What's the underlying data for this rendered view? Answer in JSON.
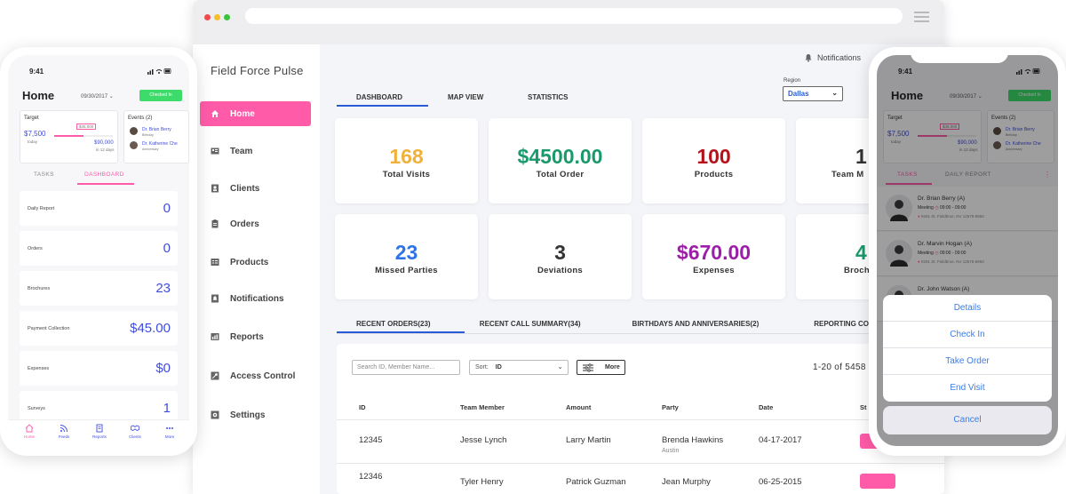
{
  "web": {
    "app_title": "Field Force Pulse",
    "notifications": "Notifications",
    "region_label": "Region",
    "region_value": "Dallas",
    "nav": [
      {
        "label": "Home",
        "icon": "home-icon"
      },
      {
        "label": "Team",
        "icon": "team-icon"
      },
      {
        "label": "Clients",
        "icon": "clients-icon"
      },
      {
        "label": "Orders",
        "icon": "orders-icon"
      },
      {
        "label": "Products",
        "icon": "products-icon"
      },
      {
        "label": "Notifications",
        "icon": "bell-icon"
      },
      {
        "label": "Reports",
        "icon": "reports-icon"
      },
      {
        "label": "Access Control",
        "icon": "key-icon"
      },
      {
        "label": "Settings",
        "icon": "gear-icon"
      }
    ],
    "tabs": [
      "DASHBOARD",
      "MAP VIEW",
      "STATISTICS"
    ],
    "cards": [
      {
        "value": "168",
        "label": "Total Visits",
        "color": "#f0b13c"
      },
      {
        "value": "$4500.00",
        "label": "Total Order",
        "color": "#1a9a6c"
      },
      {
        "value": "100",
        "label": "Products",
        "color": "#b5121b"
      },
      {
        "value": "1",
        "label": "Team M",
        "color": "#333333"
      },
      {
        "value": "23",
        "label": "Missed Parties",
        "color": "#2f74e6"
      },
      {
        "value": "3",
        "label": "Deviations",
        "color": "#333333"
      },
      {
        "value": "$670.00",
        "label": "Expenses",
        "color": "#9c1fa8"
      },
      {
        "value": "4",
        "label": "Broch",
        "color": "#1a9a6c"
      }
    ],
    "bottom_tabs": [
      "RECENT ORDERS(23)",
      "RECENT CALL SUMMARY(34)",
      "BIRTHDAYS AND ANNIVERSARIES(2)",
      "REPORTING CO"
    ],
    "search_placeholder": "Search ID, Member Name...",
    "sort_label": "Sort:",
    "sort_value": "ID",
    "more_label": "More",
    "pager": "1-20  of  5458",
    "columns": [
      "ID",
      "Team Member",
      "Amount",
      "Party",
      "Date",
      "St"
    ],
    "rows": [
      {
        "id": "12345",
        "member": "Jesse Lynch",
        "amount": "Larry Martin",
        "party": "Brenda Hawkins",
        "party_sub": "Austin",
        "date": "04-17-2017"
      },
      {
        "id": "12346",
        "member": "Tyler Henry",
        "amount": "Patrick Guzman",
        "party": "Jean Murphy",
        "party_sub": "",
        "date": "06-25-2015"
      }
    ]
  },
  "phone_left": {
    "time": "9:41",
    "title": "Home",
    "date": "09/30/2017",
    "checked_in": "Checked In",
    "target_label": "Target",
    "target_value": "$7,500",
    "target_sub": "today",
    "target_progress_label": "$45,000",
    "target_goal": "$90,000",
    "target_goal_sub": "in 12 days",
    "events_label": "Events (2)",
    "events": [
      {
        "name": "Dr. Brian Berry",
        "type": "Birthday"
      },
      {
        "name": "Dr. Katherine Che",
        "type": "Anniversary"
      }
    ],
    "tabs": [
      "TASKS",
      "DASHBOARD"
    ],
    "metrics": [
      {
        "label": "Daily Report",
        "value": "0"
      },
      {
        "label": "Orders",
        "value": "0"
      },
      {
        "label": "Brochures",
        "value": "23"
      },
      {
        "label": "Payment Collection",
        "value": "$45.00"
      },
      {
        "label": "Expenses",
        "value": "$0"
      },
      {
        "label": "Surveys",
        "value": "1"
      }
    ],
    "bottom_nav": [
      "Home",
      "Feeds",
      "Reports",
      "Clients",
      "More"
    ]
  },
  "phone_right": {
    "time": "9:41",
    "title": "Home",
    "date": "09/30/2017",
    "checked_in": "Checked In",
    "target_label": "Target",
    "target_value": "$7,500",
    "target_sub": "today",
    "target_progress_label": "$45,000",
    "target_goal": "$90,000",
    "target_goal_sub": "in 12 days",
    "events_label": "Events (2)",
    "events": [
      {
        "name": "Dr. Brian Berry",
        "type": "Birthday"
      },
      {
        "name": "Dr. Katherine Che",
        "type": "Anniversary"
      }
    ],
    "tabs": [
      "TASKS",
      "DAILY REPORT"
    ],
    "contacts": [
      {
        "name": "Dr. Brian Berry (A)",
        "meeting": "Meeting",
        "time": "09:00 - 09:00",
        "addr": "9291 St. Fieldbrue, NV 12578-8950"
      },
      {
        "name": "Dr. Marvin Hogan (A)",
        "meeting": "Meeting",
        "time": "09:00 - 09:00",
        "addr": "9291 St. Fieldbrue, NV 12578-8950"
      },
      {
        "name": "Dr. John Watson (A)",
        "meeting": "",
        "time": "",
        "addr": ""
      }
    ],
    "sheet_options": [
      "Details",
      "Check In",
      "Take Order",
      "End Visit"
    ],
    "cancel": "Cancel"
  }
}
